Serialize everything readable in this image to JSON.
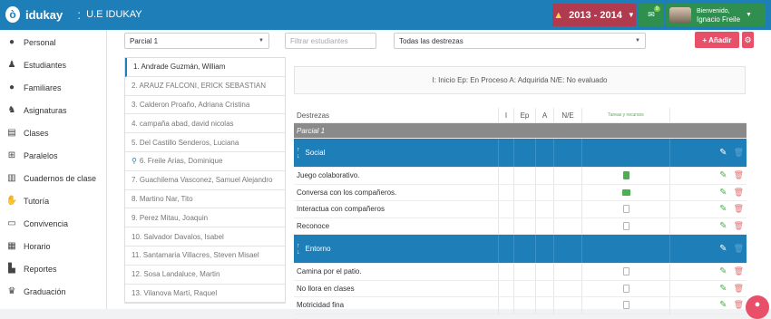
{
  "app": {
    "logo_letter": "ò",
    "name": "idukay",
    "separator": ":",
    "school": "U.E IDUKAY"
  },
  "header": {
    "year": "2013 - 2014",
    "mail_count": "9",
    "greeting": "Bienvenido,",
    "user_name": "Ignacio Freile"
  },
  "sidebar": {
    "items": [
      {
        "label": "Personal",
        "icon": "person-icon"
      },
      {
        "label": "Estudiantes",
        "icon": "student-icon"
      },
      {
        "label": "Familiares",
        "icon": "family-icon"
      },
      {
        "label": "Asignaturas",
        "icon": "subjects-icon"
      },
      {
        "label": "Clases",
        "icon": "class-icon"
      },
      {
        "label": "Paralelos",
        "icon": "sitemap-icon"
      },
      {
        "label": "Cuadernos de clase",
        "icon": "book-icon"
      },
      {
        "label": "Tutoría",
        "icon": "thumbs-up-icon"
      },
      {
        "label": "Convivencia",
        "icon": "list-icon"
      },
      {
        "label": "Horario",
        "icon": "calendar-icon"
      },
      {
        "label": "Reportes",
        "icon": "bar-chart-icon"
      },
      {
        "label": "Graduación",
        "icon": "graduation-cap-icon"
      }
    ]
  },
  "filters": {
    "period": "Parcial 1",
    "search_placeholder": "Filtrar estudiantes",
    "skills": "Todas las destrezas",
    "add_label": "+ Añadir"
  },
  "students": [
    "1. Andrade Guzmán, William",
    "2. ARAUZ FALCONI, ERICK SEBASTIAN",
    "3. Calderon Proaño, Adriana Cristina",
    "4. campaña abad, david nicolas",
    "5. Del Castillo Senderos, Luciana",
    "6. Freile Arias, Dominique",
    "7. Guachilema Vasconez, Samuel Alejandro",
    "8. Martino Nar, Tito",
    "9. Perez Mitau, Joaquin",
    "10. Salvador Davalos, Isabel",
    "11. Santamaria Villacres, Steven Misael",
    "12. Sosa Landaluce, Martin",
    "13. Vilanova Martí, Raquel"
  ],
  "legend": "I: Inicio   Ep: En Proceso   A: Adquirida   N/E: No evaluado",
  "table": {
    "headers": {
      "skills": "Destrezas",
      "i": "I",
      "ep": "Ep",
      "a": "A",
      "ne": "N/E",
      "tasks": "Tareas y recursos"
    },
    "period_row": "Parcial 1",
    "groups": [
      {
        "name": "Social",
        "rows": [
          {
            "label": "Juego colaborativo.",
            "resource": "file-green"
          },
          {
            "label": "Conversa con los compañeros.",
            "resource": "video-green"
          },
          {
            "label": "Interactua con compañeros",
            "resource": "file-empty"
          },
          {
            "label": "Reconoce",
            "resource": "file-empty"
          }
        ]
      },
      {
        "name": "Entorno",
        "rows": [
          {
            "label": "Camina por el patio.",
            "resource": "file-empty"
          },
          {
            "label": "No llora en clases",
            "resource": "file-empty"
          },
          {
            "label": "Motricidad fina",
            "resource": "file-empty"
          }
        ]
      }
    ]
  },
  "colors": {
    "primary": "#1d7eb8",
    "danger": "#e8506a",
    "success": "#2e8f4e",
    "year_bg": "#b03a4e"
  }
}
